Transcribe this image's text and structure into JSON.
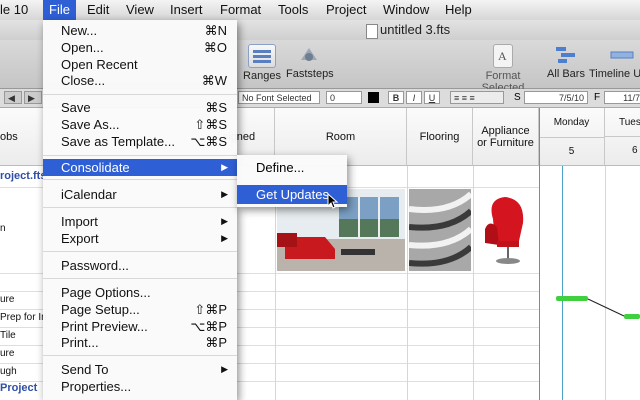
{
  "menubar": {
    "app_partial": "le 10",
    "items": [
      "File",
      "Edit",
      "View",
      "Insert",
      "Format",
      "Tools",
      "Project",
      "Window",
      "Help"
    ],
    "active": "File"
  },
  "window": {
    "title": "untitled 3.fts"
  },
  "toolbar": {
    "ranges": "Ranges",
    "faststeps": "Faststeps",
    "format_selected": "Format Selected",
    "all_bars": "All Bars",
    "timeline": "Timeline U"
  },
  "format_bar": {
    "font": "No Font Selected",
    "size": "0",
    "bold": "B",
    "italic": "I",
    "underline": "U",
    "start_label": "S",
    "start_date": "7/5/10",
    "finish_label": "F",
    "finish_date": "11/7"
  },
  "grid": {
    "columns": {
      "jobs": "obs",
      "assigned": "signed",
      "room": "Room",
      "flooring": "Flooring",
      "appliance": "Appliance or Furniture",
      "monday": "Monday",
      "monday_num": "5",
      "tuesday": "Tuesd",
      "tuesday_num": "6"
    },
    "rows": [
      "roject.fts",
      "n",
      "ure",
      "Prep for In",
      "Tile",
      "ure",
      "ugh",
      "Project"
    ]
  },
  "file_menu": {
    "items": [
      {
        "label": "New...",
        "shortcut": "⌘N"
      },
      {
        "label": "Open...",
        "shortcut": "⌘O"
      },
      {
        "label": "Open Recent",
        "shortcut": ""
      },
      {
        "label": "Close...",
        "shortcut": "⌘W"
      },
      {
        "label": "Save",
        "shortcut": "⌘S"
      },
      {
        "label": "Save As...",
        "shortcut": "⇧⌘S"
      },
      {
        "label": "Save as Template...",
        "shortcut": "⌥⌘S"
      },
      {
        "label": "Consolidate",
        "shortcut": ""
      },
      {
        "label": "iCalendar",
        "shortcut": ""
      },
      {
        "label": "Import",
        "shortcut": ""
      },
      {
        "label": "Export",
        "shortcut": ""
      },
      {
        "label": "Password...",
        "shortcut": ""
      },
      {
        "label": "Page Options...",
        "shortcut": ""
      },
      {
        "label": "Page Setup...",
        "shortcut": "⇧⌘P"
      },
      {
        "label": "Print Preview...",
        "shortcut": "⌥⌘P"
      },
      {
        "label": "Print...",
        "shortcut": "⌘P"
      },
      {
        "label": "Send To",
        "shortcut": ""
      },
      {
        "label": "Properties...",
        "shortcut": ""
      }
    ],
    "highlighted": "Consolidate"
  },
  "consolidate_submenu": {
    "items": [
      "Define...",
      "Get Updates"
    ],
    "highlighted": "Get Updates"
  },
  "colors": {
    "highlight": "#2f5fd4",
    "bar": "#3fcf3f",
    "timeline": "#4aa3c8"
  }
}
